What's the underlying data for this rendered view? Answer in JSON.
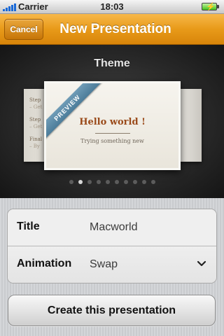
{
  "status_bar": {
    "carrier": "Carrier",
    "time": "18:03",
    "battery_icon": "charging-battery-icon",
    "signal_icon": "signal-bars-icon",
    "battery_color": "#43c21a"
  },
  "nav": {
    "cancel_label": "Cancel",
    "title": "New Presentation",
    "accent": "#e89a19"
  },
  "theme": {
    "label": "Theme",
    "preview_badge": "PREVIEW",
    "card_title": "Hello world !",
    "card_subtitle": "Trying something new",
    "side_card_left_lines": [
      "Step",
      "– Get",
      "Step",
      "– Get",
      "Final",
      "– By"
    ],
    "page_count": 10,
    "current_page": 2
  },
  "form": {
    "title_label": "Title",
    "title_value": "Macworld",
    "animation_label": "Animation",
    "animation_value": "Swap",
    "dropdown_icon": "chevron-down-icon"
  },
  "actions": {
    "create_label": "Create this presentation"
  }
}
